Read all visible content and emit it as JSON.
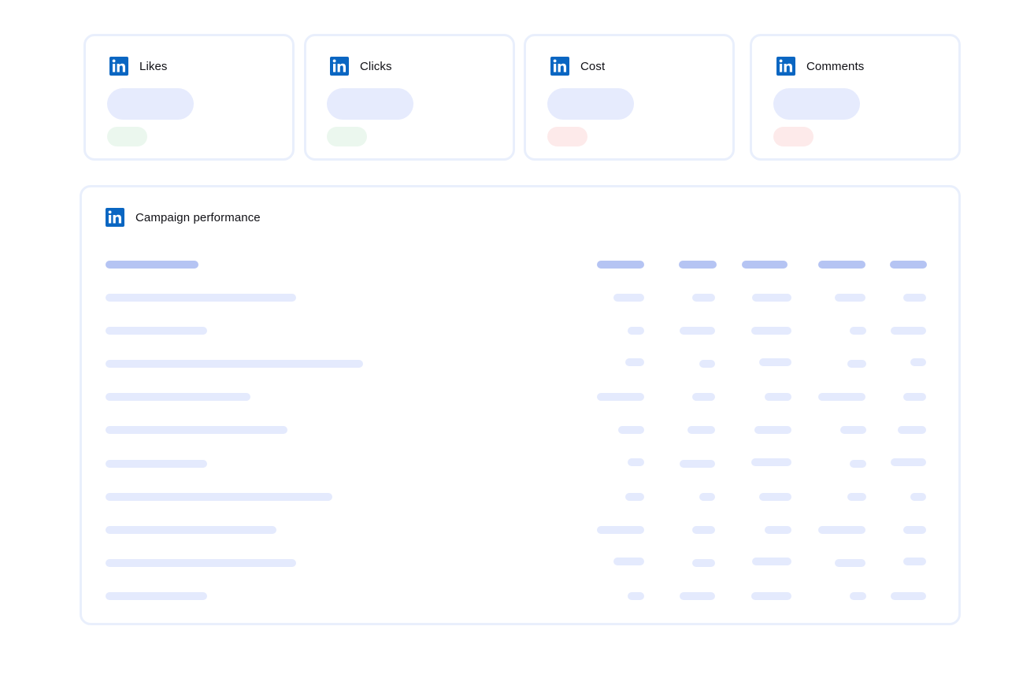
{
  "kpi_cards": [
    {
      "id": "likes",
      "title": "Likes",
      "icon": "linkedin-icon",
      "delta_trend": "positive",
      "delta_color": "#ebf7ee"
    },
    {
      "id": "clicks",
      "title": "Clicks",
      "icon": "linkedin-icon",
      "delta_trend": "positive",
      "delta_color": "#ebf7ee"
    },
    {
      "id": "cost",
      "title": "Cost",
      "icon": "linkedin-icon",
      "delta_trend": "negative",
      "delta_color": "#fdeaea"
    },
    {
      "id": "comments",
      "title": "Comments",
      "icon": "linkedin-icon",
      "delta_trend": "negative",
      "delta_color": "#fdeaea"
    }
  ],
  "performance": {
    "title": "Campaign performance",
    "icon": "linkedin-icon",
    "column_count": 6,
    "row_count": 10,
    "state": "loading-skeleton"
  },
  "colors": {
    "linkedin_brand": "#0a66c2",
    "card_border": "#e9effc",
    "skeleton_value": "#e6ebfd",
    "skeleton_header": "#b5c4f3",
    "skeleton_cell": "#e4eafd"
  }
}
